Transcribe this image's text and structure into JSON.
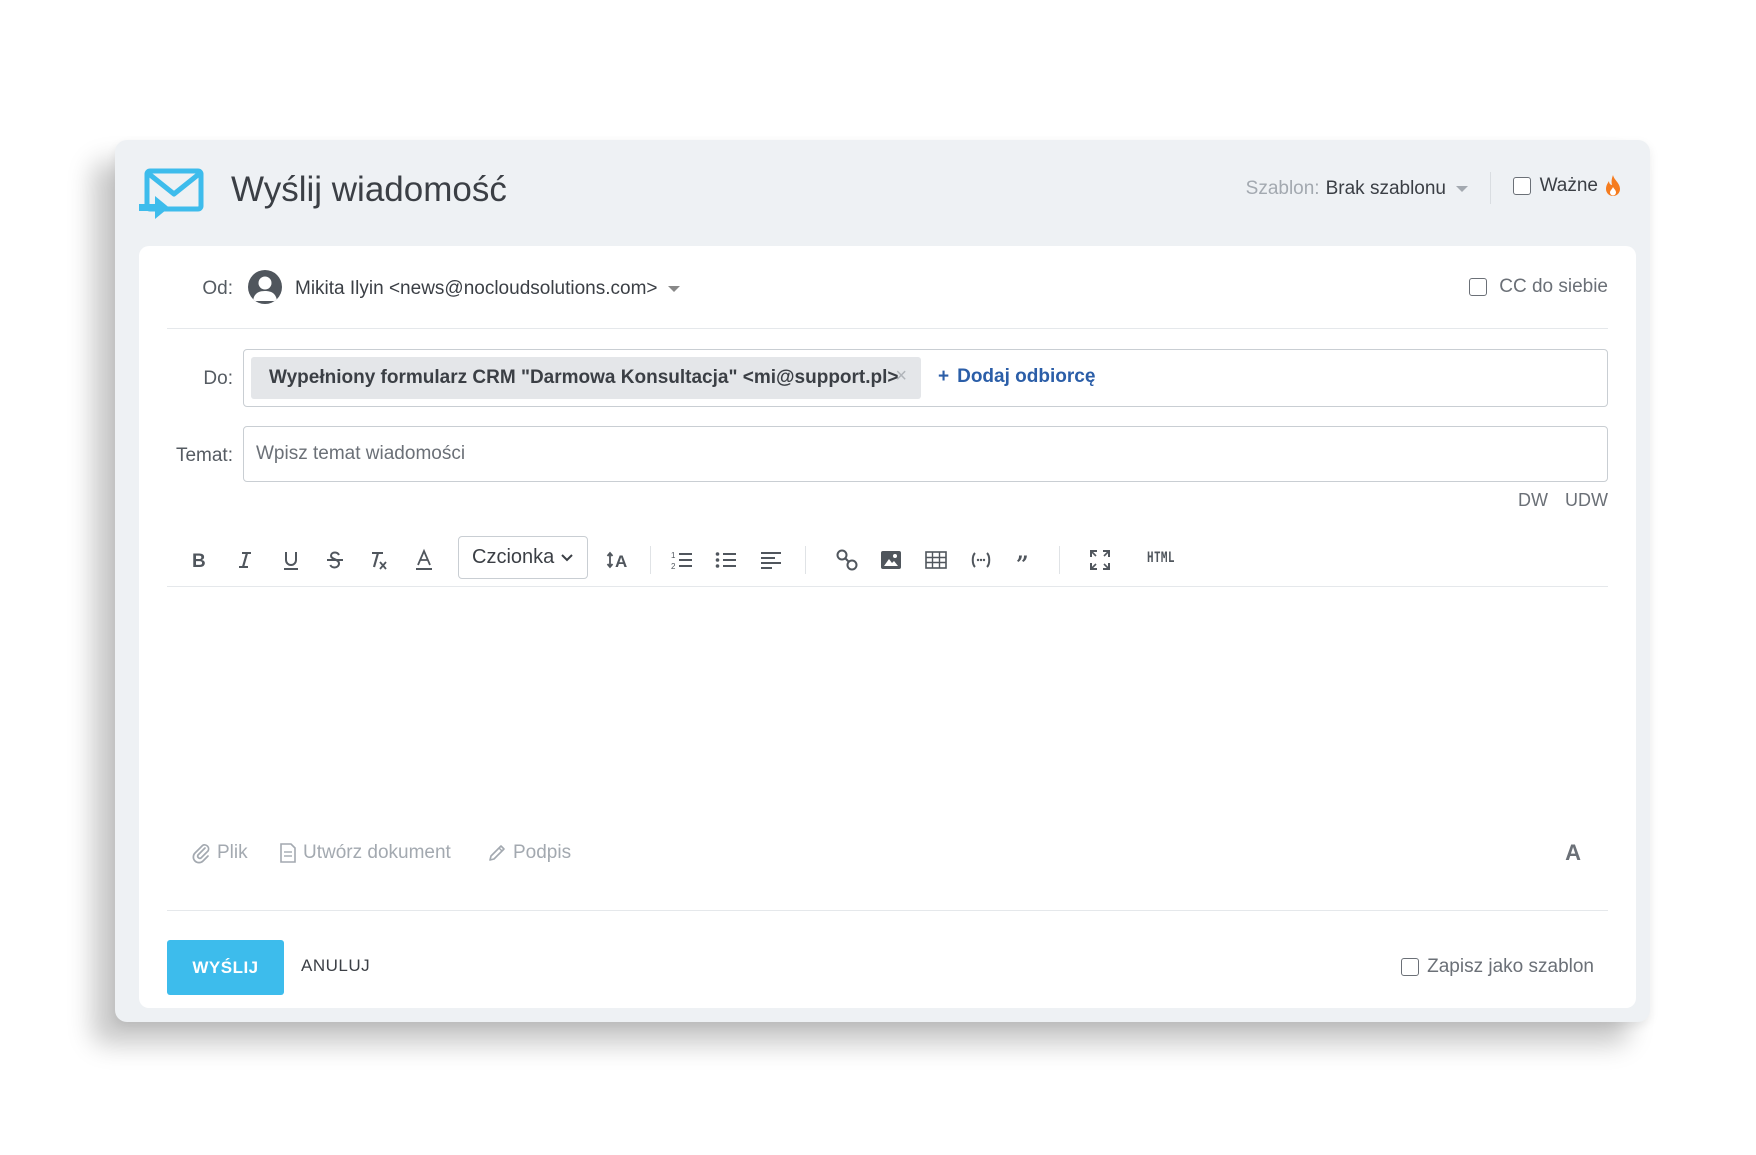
{
  "header": {
    "title": "Wyślij wiadomość",
    "template_label": "Szablon:",
    "template_value": "Brak szablonu",
    "important_label": "Ważne"
  },
  "from": {
    "label": "Od:",
    "value": "Mikita Ilyin <news@nocloudsolutions.com>",
    "cc_self_label": "CC do siebie"
  },
  "to": {
    "label": "Do:",
    "recipient": "Wypełniony formularz CRM \"Darmowa Konsultacja\" <mi@support.pl>",
    "add_recipient": "Dodaj odbiorcę"
  },
  "subject": {
    "label": "Temat:",
    "placeholder": "Wpisz temat wiadomości",
    "dw": "DW",
    "udw": "UDW"
  },
  "toolbar": {
    "font_select": "Czcionka",
    "html_label": "HTML"
  },
  "attachments": {
    "file": "Plik",
    "create_document": "Utwórz dokument",
    "signature": "Podpis",
    "font_toggle": "A"
  },
  "footer": {
    "send": "WYŚLIJ",
    "cancel": "ANULUJ",
    "save_template": "Zapisz jako szablon"
  },
  "colors": {
    "accent": "#3dbcec",
    "link": "#2b5ea8",
    "flame": "#f57c1f",
    "header_bg": "#eef1f4"
  }
}
